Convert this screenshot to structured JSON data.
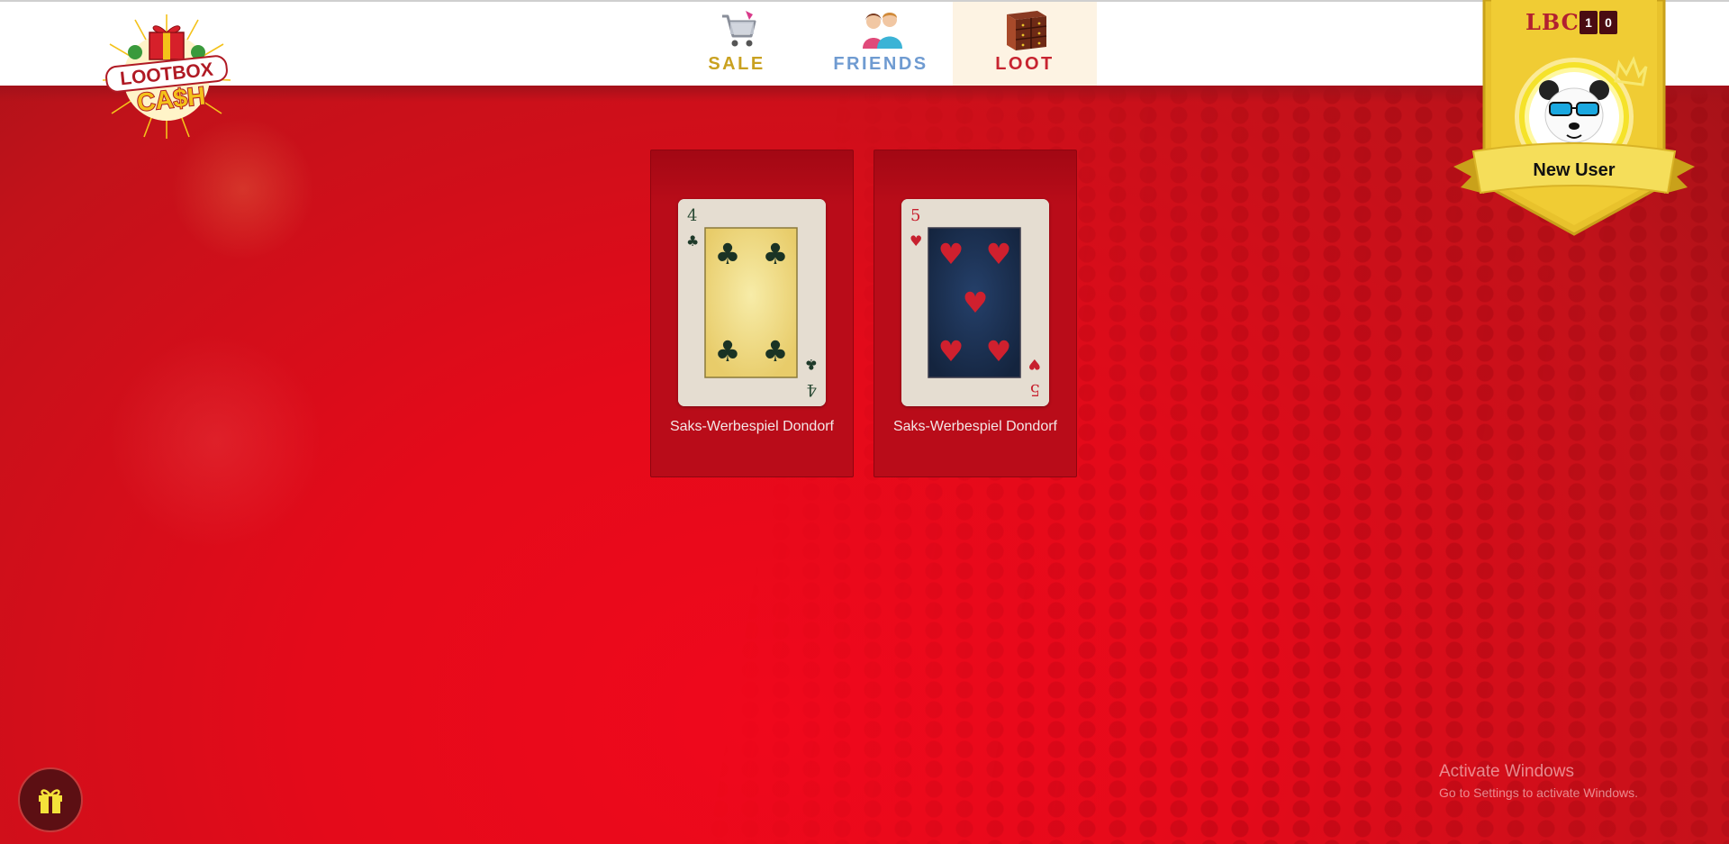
{
  "logo": {
    "line1": "LOOTBOX",
    "line2": "CA$H"
  },
  "nav": {
    "tabs": [
      {
        "label": "SALE",
        "icon": "shopping-cart-icon"
      },
      {
        "label": "FRIENDS",
        "icon": "friends-icon"
      },
      {
        "label": "LOOT",
        "icon": "chest-of-drawers-icon",
        "active": true
      }
    ]
  },
  "profile": {
    "currency_label": "LBC",
    "currency_digits": [
      "1",
      "0"
    ],
    "username": "New User",
    "avatar": "panda-with-sunglasses-avatar"
  },
  "cards": [
    {
      "name": "Saks-Werbespiel Dondorf",
      "rank": "4",
      "suit": "clubs",
      "suit_symbol": "♣",
      "suit_color": "#1f3a2a",
      "face_color": "#f0d98a"
    },
    {
      "name": "Saks-Werbespiel Dondorf",
      "rank": "5",
      "suit": "hearts",
      "suit_symbol": "♥",
      "suit_color": "#c7202e",
      "face_color": "#1d2f4e"
    }
  ],
  "gift_button": {
    "icon": "gift-icon"
  },
  "watermark": {
    "title": "Activate Windows",
    "subtitle": "Go to Settings to activate Windows."
  },
  "colors": {
    "background": "#e40a1a",
    "header": "#ffffff",
    "accent_gold": "#e8c22c"
  }
}
